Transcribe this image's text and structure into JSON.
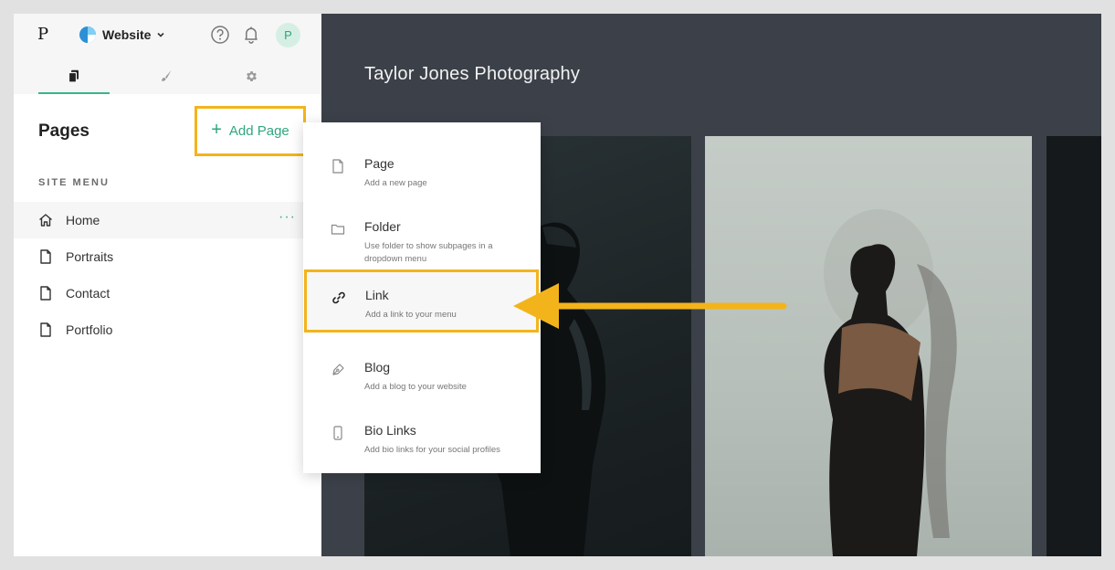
{
  "topbar": {
    "logo": "P",
    "site_name": "Website",
    "avatar_initial": "P"
  },
  "tabs": [
    {
      "name": "pages"
    },
    {
      "name": "design"
    },
    {
      "name": "settings"
    }
  ],
  "sidebar": {
    "title": "Pages",
    "add_page_label": "Add Page",
    "add_page_plus": "+",
    "site_menu_heading": "SITE MENU",
    "items": [
      {
        "label": "Home",
        "icon": "home-icon",
        "selected": true,
        "more": "···"
      },
      {
        "label": "Portraits",
        "icon": "page-icon"
      },
      {
        "label": "Contact",
        "icon": "page-icon"
      },
      {
        "label": "Portfolio",
        "icon": "page-icon"
      }
    ]
  },
  "dropdown": {
    "items": [
      {
        "title": "Page",
        "desc": "Add a new page",
        "icon": "page-icon"
      },
      {
        "title": "Folder",
        "desc": "Use folder to show subpages in a dropdown menu",
        "icon": "folder-icon"
      },
      {
        "title": "Link",
        "desc": "Add a link to your menu",
        "icon": "link-icon"
      },
      {
        "title": "Blog",
        "desc": "Add a blog to your website",
        "icon": "pen-icon"
      },
      {
        "title": "Bio Links",
        "desc": "Add bio links for your social profiles",
        "icon": "phone-icon"
      }
    ]
  },
  "preview": {
    "site_title": "Taylor Jones Photography"
  },
  "colors": {
    "accent": "#36b58d",
    "highlight": "#f3b41b",
    "preview_bg": "#3c4149"
  }
}
